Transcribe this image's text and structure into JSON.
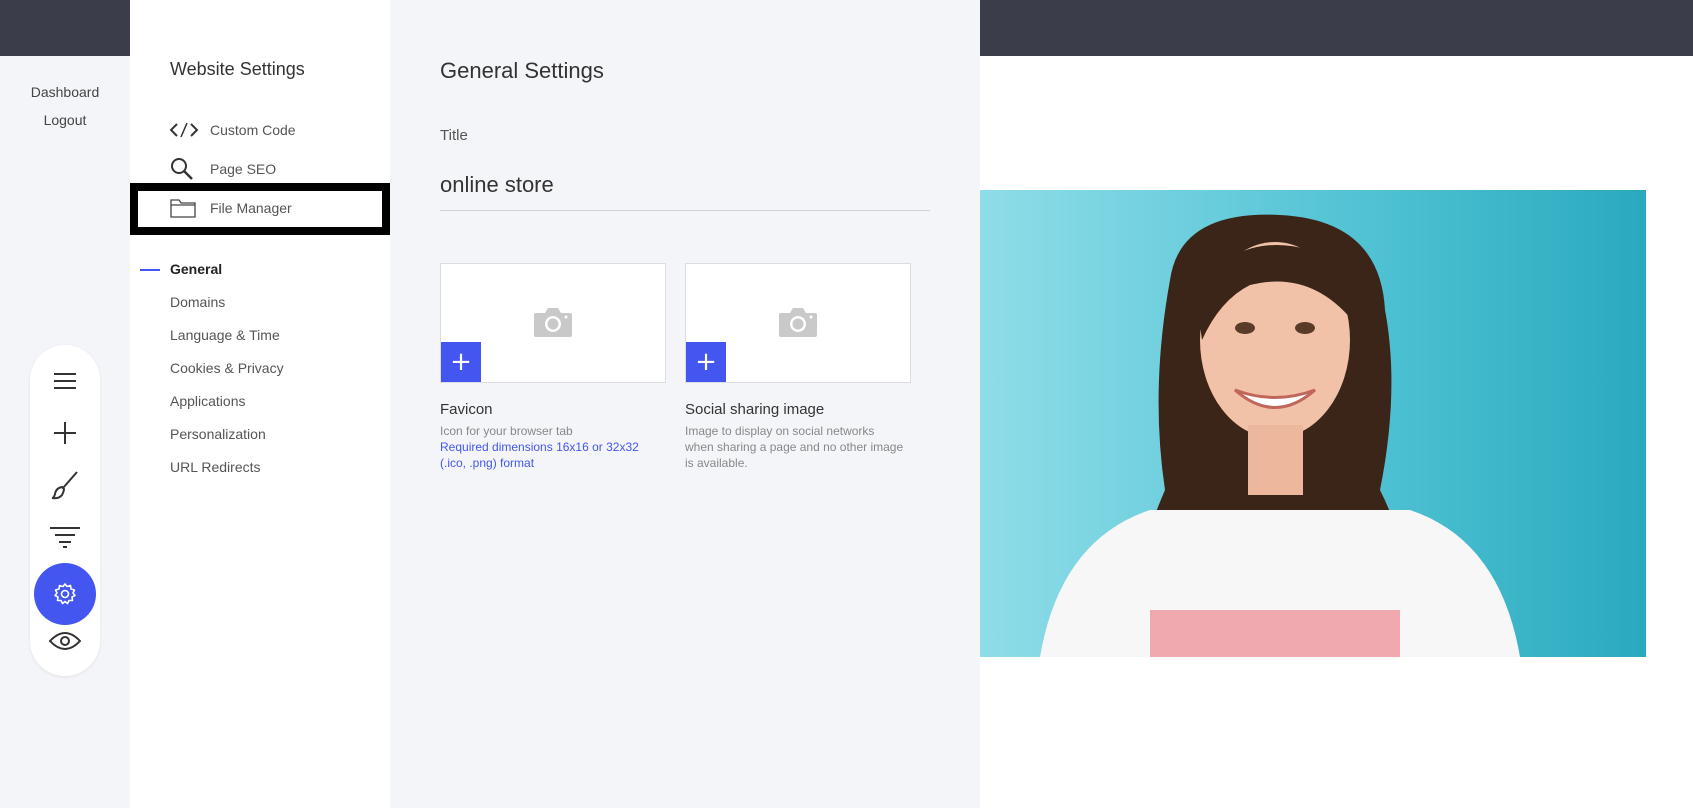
{
  "left_links": [
    "Dashboard",
    "Logout"
  ],
  "toolbar": {
    "tools": [
      {
        "name": "menu-icon"
      },
      {
        "name": "plus-icon"
      },
      {
        "name": "brush-icon"
      },
      {
        "name": "filter-icon"
      },
      {
        "name": "gear-icon",
        "active": true
      },
      {
        "name": "eye-icon"
      }
    ],
    "accent": "#4356f0"
  },
  "nav": {
    "title": "Website Settings",
    "tools": [
      {
        "label": "Custom Code",
        "icon": "code-icon"
      },
      {
        "label": "Page SEO",
        "icon": "search-icon"
      },
      {
        "label": "File Manager",
        "icon": "folder-icon"
      }
    ],
    "menu": [
      {
        "label": "General",
        "active": true
      },
      {
        "label": "Domains"
      },
      {
        "label": "Language & Time"
      },
      {
        "label": "Cookies & Privacy"
      },
      {
        "label": "Applications"
      },
      {
        "label": "Personalization"
      },
      {
        "label": "URL Redirects"
      }
    ]
  },
  "main": {
    "title": "General Settings",
    "field_label": "Title",
    "title_value": "online store",
    "uploads": [
      {
        "name": "Favicon",
        "desc": "Icon for your browser tab",
        "requirement": "Required dimensions 16x16 or 32x32 (.ico, .png) format"
      },
      {
        "name": "Social sharing image",
        "desc": "Image to display on social networks when sharing a page and no other image is available."
      }
    ]
  },
  "colors": {
    "topbar": "#3b3e4a",
    "accent": "#4356f0",
    "photo_bg": "#79d4e2"
  }
}
